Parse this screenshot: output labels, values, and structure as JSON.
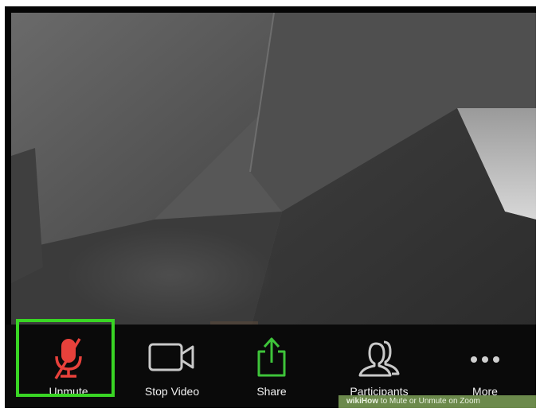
{
  "meeting": {
    "video_feed": {
      "description_icon": "camera-feed"
    },
    "toolbar": {
      "items": [
        {
          "id": "unmute",
          "label": "Unmute",
          "icon": "microphone-muted-icon",
          "color": "#e8413b",
          "highlighted": true
        },
        {
          "id": "stop_video",
          "label": "Stop Video",
          "icon": "video-camera-icon",
          "color": "#c9c9c9"
        },
        {
          "id": "share",
          "label": "Share",
          "icon": "share-upload-icon",
          "color": "#3ec43a"
        },
        {
          "id": "participants",
          "label": "Participants",
          "icon": "participants-icon",
          "color": "#c9c9c9"
        },
        {
          "id": "more",
          "label": "More",
          "icon": "more-dots-icon",
          "color": "#d0d0d0"
        }
      ]
    },
    "highlight_color": "#39d524"
  },
  "watermark": {
    "brand": "wiki",
    "brand2": "How",
    "text": "to Mute or Unmute on Zoom"
  }
}
